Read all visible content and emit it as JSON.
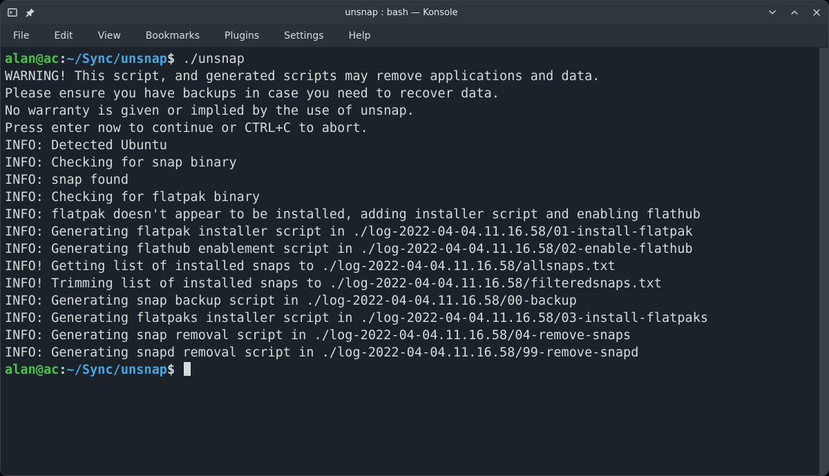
{
  "titlebar": {
    "app_icon": "terminal-icon",
    "pin_icon": "pin-icon",
    "title": "unsnap : bash — Konsole",
    "minimize_icon": "minimize-icon",
    "maximize_icon": "maximize-icon",
    "close_icon": "close-icon"
  },
  "menubar": {
    "items": [
      "File",
      "Edit",
      "View",
      "Bookmarks",
      "Plugins",
      "Settings",
      "Help"
    ]
  },
  "terminal": {
    "prompt1": {
      "user": "alan@ac",
      "sep": ":",
      "path": "~/Sync/unsnap",
      "dollar": "$",
      "command": "./unsnap"
    },
    "lines": [
      "WARNING! This script, and generated scripts may remove applications and data.",
      "Please ensure you have backups in case you need to recover data.",
      "No warranty is given or implied by the use of unsnap.",
      "Press enter now to continue or CTRL+C to abort.",
      "INFO: Detected Ubuntu",
      "INFO: Checking for snap binary",
      "INFO: snap found",
      "INFO: Checking for flatpak binary",
      "INFO: flatpak doesn't appear to be installed, adding installer script and enabling flathub",
      "INFO: Generating flatpak installer script in ./log-2022-04-04.11.16.58/01-install-flatpak",
      "INFO: Generating flathub enablement script in ./log-2022-04-04.11.16.58/02-enable-flathub",
      "INFO! Getting list of installed snaps to ./log-2022-04-04.11.16.58/allsnaps.txt",
      "INFO! Trimming list of installed snaps to ./log-2022-04-04.11.16.58/filteredsnaps.txt",
      "INFO: Generating snap backup script in ./log-2022-04-04.11.16.58/00-backup",
      "INFO: Generating flatpaks installer script in ./log-2022-04-04.11.16.58/03-install-flatpaks",
      "INFO: Generating snap removal script in ./log-2022-04-04.11.16.58/04-remove-snaps",
      "INFO: Generating snapd removal script in ./log-2022-04-04.11.16.58/99-remove-snapd"
    ],
    "prompt2": {
      "user": "alan@ac",
      "sep": ":",
      "path": "~/Sync/unsnap",
      "dollar": "$",
      "command": ""
    }
  }
}
